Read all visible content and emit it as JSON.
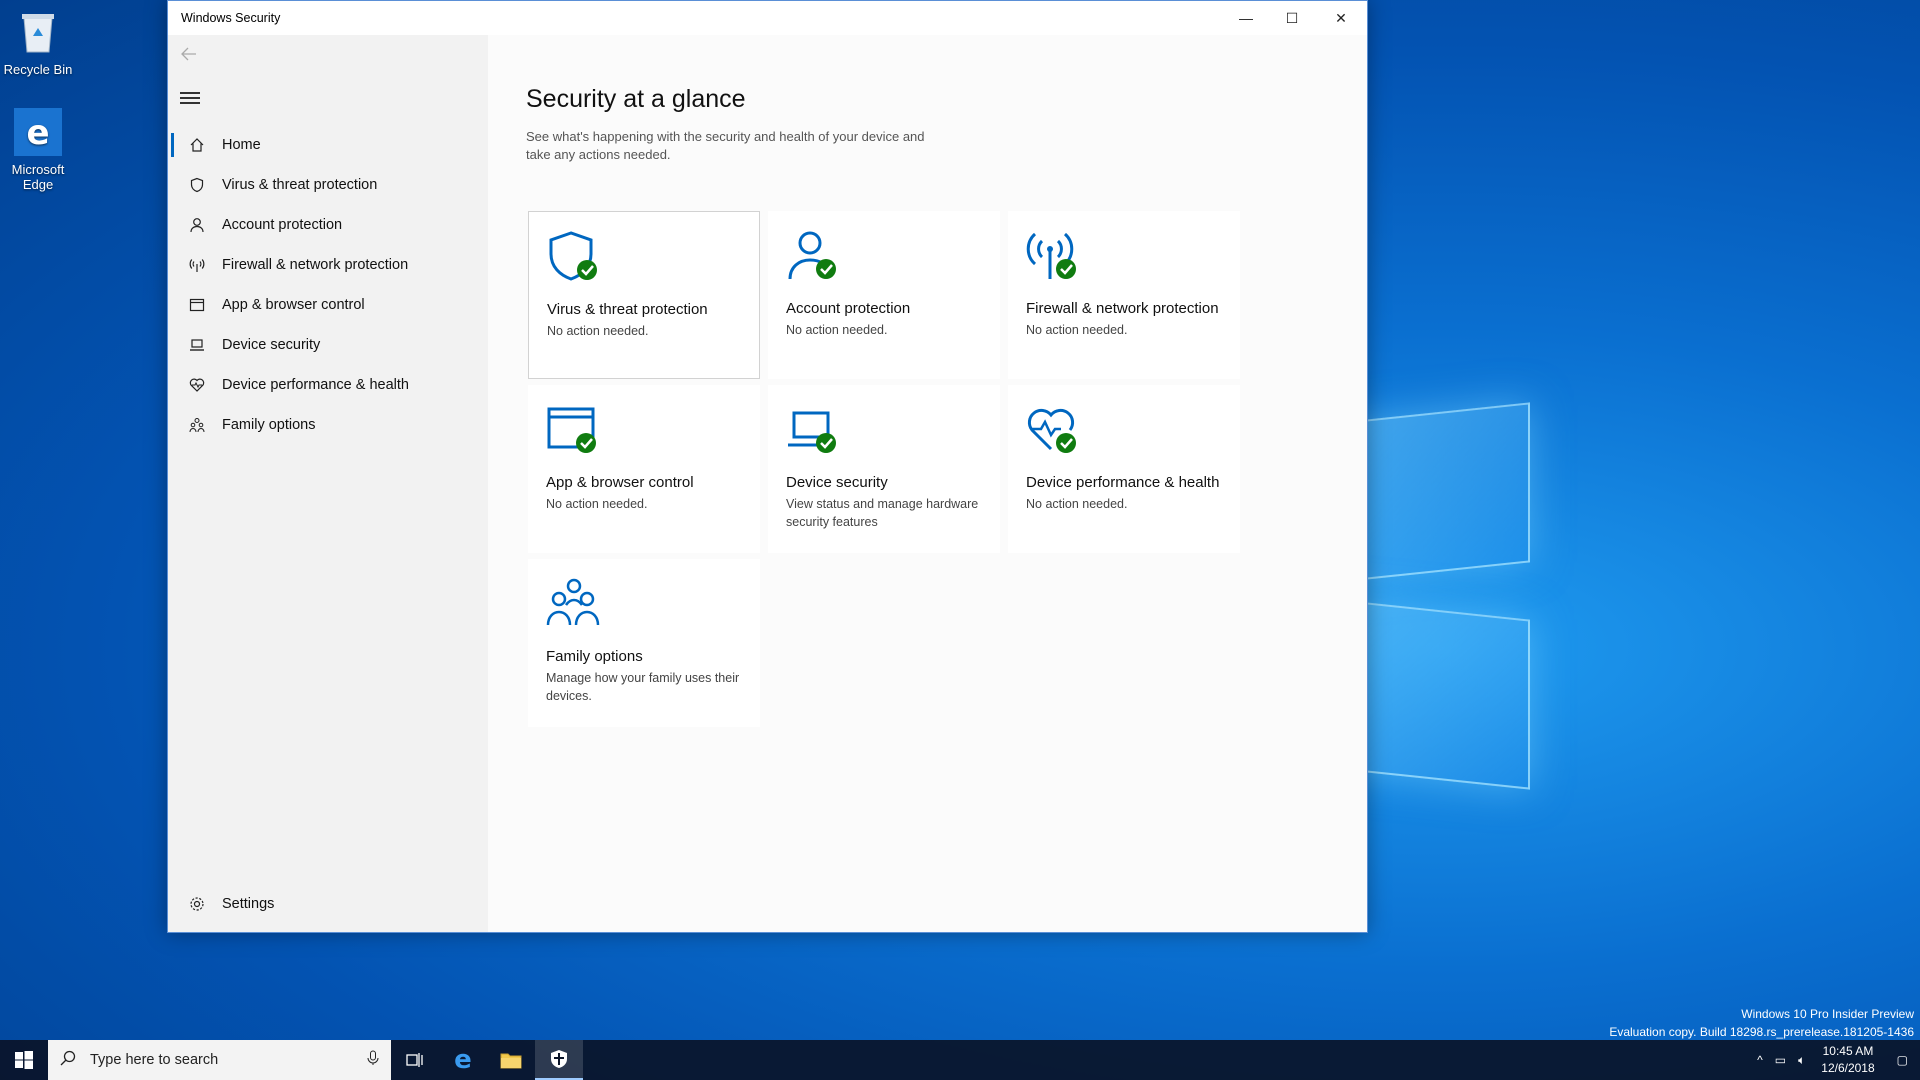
{
  "desktop": {
    "icons": [
      {
        "label": "Recycle Bin"
      },
      {
        "label": "Microsoft Edge"
      }
    ],
    "watermark": {
      "line1": "Windows 10 Pro Insider Preview",
      "line2": "Evaluation copy. Build 18298.rs_prerelease.181205-1436"
    }
  },
  "window": {
    "title": "Windows Security",
    "controls": {
      "minimize": "—",
      "maximize": "☐",
      "close": "✕"
    }
  },
  "sidebar": {
    "items": [
      {
        "label": "Home",
        "icon": "home-icon",
        "active": true
      },
      {
        "label": "Virus & threat protection",
        "icon": "shield-icon"
      },
      {
        "label": "Account protection",
        "icon": "person-icon"
      },
      {
        "label": "Firewall & network protection",
        "icon": "antenna-icon"
      },
      {
        "label": "App & browser control",
        "icon": "browser-window-icon"
      },
      {
        "label": "Device security",
        "icon": "laptop-icon"
      },
      {
        "label": "Device performance & health",
        "icon": "heart-icon"
      },
      {
        "label": "Family options",
        "icon": "family-icon"
      }
    ],
    "settings_label": "Settings"
  },
  "main": {
    "title": "Security at a glance",
    "description": "See what's happening with the security and health of your device and take any actions needed.",
    "tiles": [
      {
        "name": "Virus & threat protection",
        "status": "No action needed.",
        "icon": "shield-check-icon"
      },
      {
        "name": "Account protection",
        "status": "No action needed.",
        "icon": "person-check-icon"
      },
      {
        "name": "Firewall & network protection",
        "status": "No action needed.",
        "icon": "antenna-check-icon"
      },
      {
        "name": "App & browser control",
        "status": "No action needed.",
        "icon": "browser-check-icon"
      },
      {
        "name": "Device security",
        "status": "View status and manage hardware security features",
        "icon": "laptop-check-icon"
      },
      {
        "name": "Device performance & health",
        "status": "No action needed.",
        "icon": "heart-check-icon"
      },
      {
        "name": "Family options",
        "status": "Manage how your family uses their devices.",
        "icon": "family-icon"
      }
    ]
  },
  "taskbar": {
    "search_placeholder": "Type here to search",
    "time": "10:45 AM",
    "date": "12/6/2018"
  },
  "colors": {
    "accent": "#0067c0",
    "check": "#107c10"
  }
}
